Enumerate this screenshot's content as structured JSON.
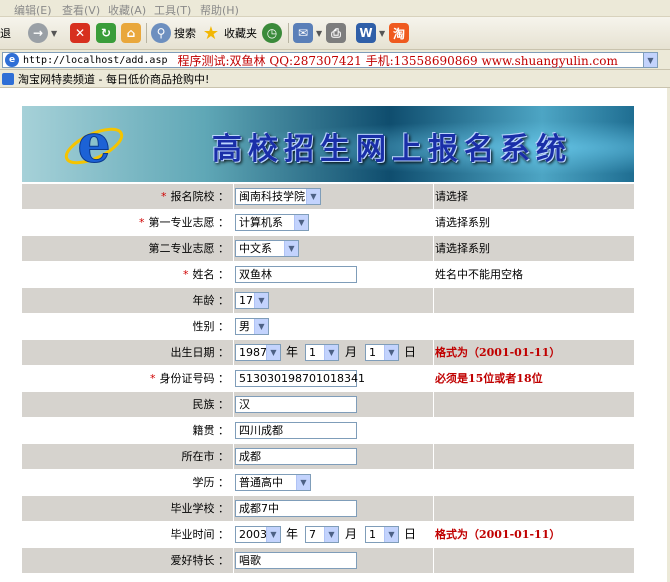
{
  "menubar": {
    "items": [
      "编辑(E)",
      "查看(V)",
      "收藏(A)",
      "工具(T)",
      "帮助(H)"
    ]
  },
  "toolbar": {
    "back_label": "退",
    "search_label": "搜索",
    "favorites_label": "收藏夹"
  },
  "address": {
    "url": "http://localhost/add.asp",
    "page_title": "程序测试:双鱼林 QQ:287307421 手机:13558690869 www.shuangyulin.com"
  },
  "links": {
    "text": "淘宝网特卖频道 - 每日低价商品抢购中!"
  },
  "banner": {
    "title": "高校招生网上报名系统"
  },
  "form": {
    "colon": "：",
    "school_label": "报名院校",
    "school_value": "闽南科技学院",
    "school_hint": "请选择",
    "major1_label": "第一专业志愿",
    "major1_value": "计算机系",
    "major1_hint": "请选择系别",
    "major2_label": "第二专业志愿",
    "major2_value": "中文系",
    "major2_hint": "请选择系别",
    "name_label": "姓名",
    "name_value": "双鱼林",
    "name_hint": "姓名中不能用空格",
    "age_label": "年龄",
    "age_value": "17",
    "gender_label": "性别",
    "gender_value": "男",
    "birth_label": "出生日期",
    "birth_year": "1987",
    "birth_month": "1",
    "birth_day": "1",
    "year_unit": "年",
    "month_unit": "月",
    "day_unit": "日",
    "date_hint": "格式为（2001-01-11）",
    "id_label": "身份证号码",
    "id_value": "513030198701018341",
    "id_hint": "必须是15位或者18位",
    "ethnic_label": "民族",
    "ethnic_value": "汉",
    "native_label": "籍贯",
    "native_value": "四川成都",
    "city_label": "所在市",
    "city_value": "成都",
    "edu_label": "学历",
    "edu_value": "普通高中",
    "grad_school_label": "毕业学校",
    "grad_school_value": "成都7中",
    "grad_time_label": "毕业时间",
    "grad_year": "2003",
    "grad_month": "7",
    "grad_day": "1",
    "specialty_label": "爱好特长",
    "specialty_value": "唱歌"
  }
}
